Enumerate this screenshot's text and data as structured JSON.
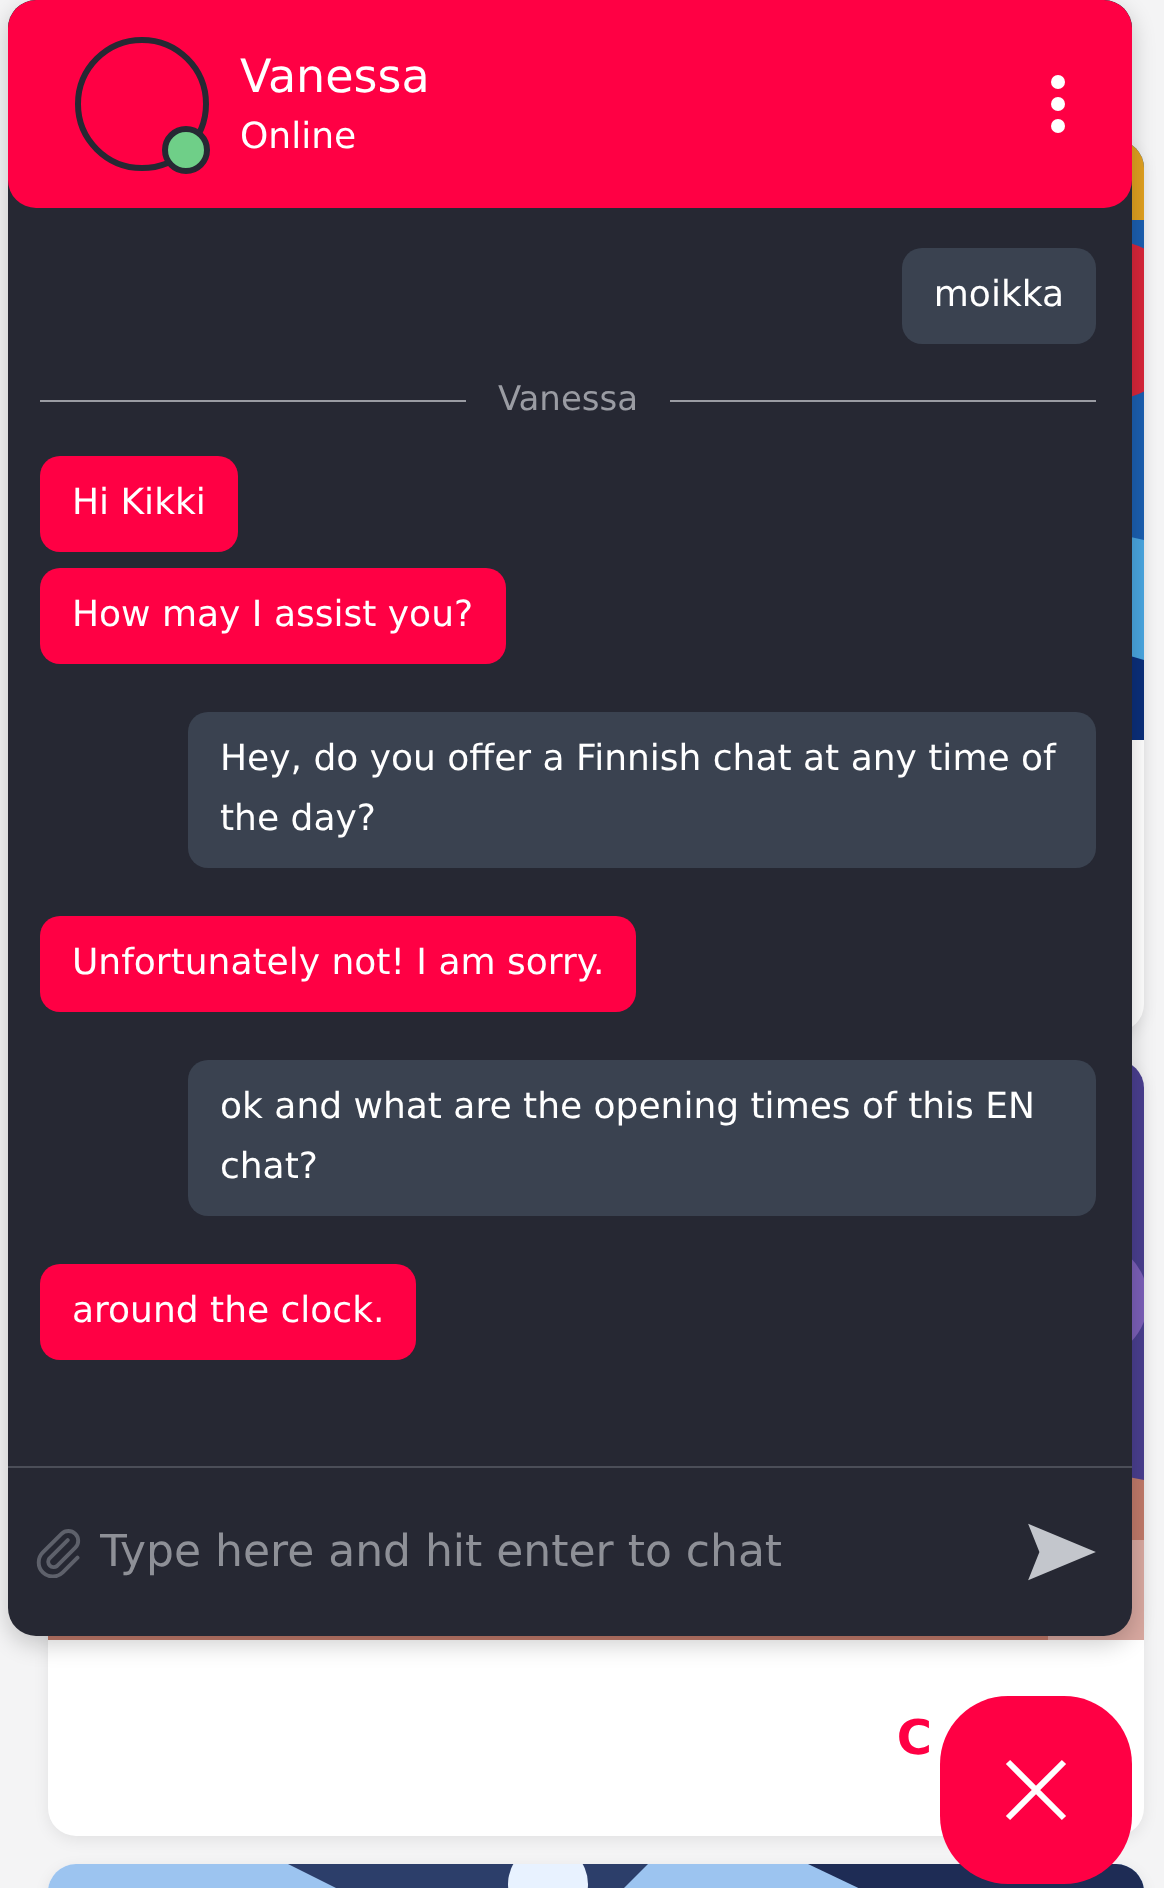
{
  "header": {
    "name": "Vanessa",
    "status": "Online",
    "online": true
  },
  "messages": [
    {
      "kind": "user",
      "text": "moikka"
    },
    {
      "kind": "divider",
      "text": "Vanessa"
    },
    {
      "kind": "agent",
      "text": "Hi Kikki"
    },
    {
      "kind": "agent",
      "text": "How may I assist you?"
    },
    {
      "kind": "user",
      "text": "Hey, do you offer a Finnish chat at any time of the day?"
    },
    {
      "kind": "agent",
      "text": "Unfortunately not! I am sorry."
    },
    {
      "kind": "user",
      "text": "ok and what are the opening times of this EN chat?"
    },
    {
      "kind": "agent",
      "text": "around the clock."
    }
  ],
  "composer": {
    "placeholder": "Type here and hit enter to chat"
  },
  "background_card": {
    "text": "C"
  }
}
